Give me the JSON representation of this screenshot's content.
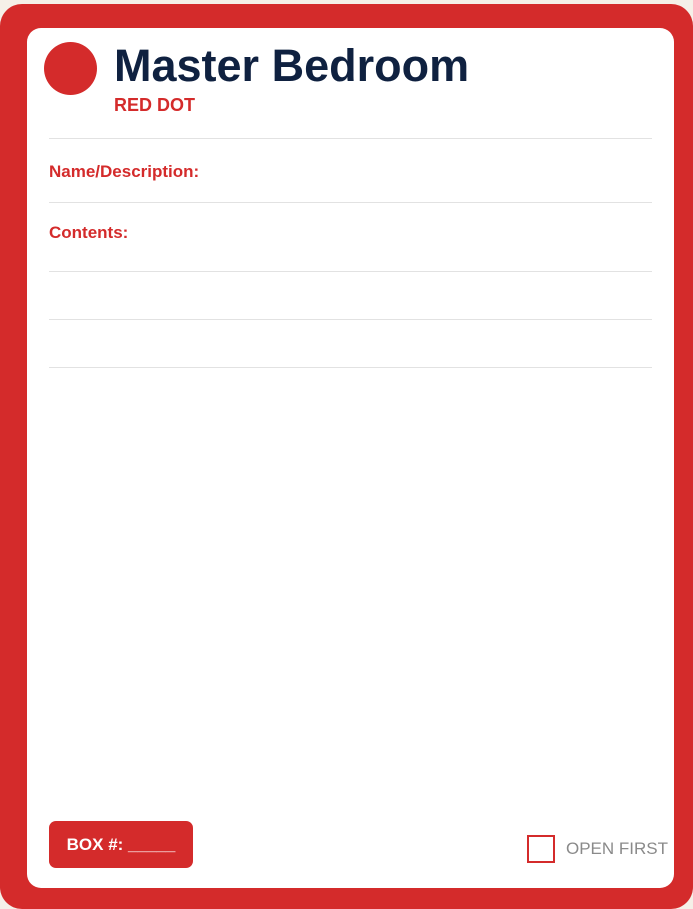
{
  "label": {
    "room_name": "Master Bedroom",
    "color_code": "RED DOT",
    "fields": {
      "name_description": "Name/Description:",
      "contents": "Contents:"
    },
    "box_number": "BOX #: _____",
    "open_first": "OPEN FIRST"
  },
  "colors": {
    "accent": "#d42b2b",
    "title": "#0f2140",
    "rule": "#e2e2e2"
  }
}
